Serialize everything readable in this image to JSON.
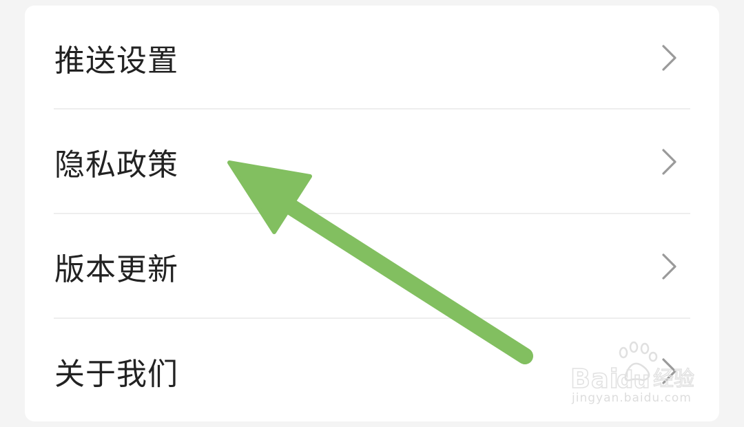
{
  "settings": {
    "items": [
      {
        "label": "推送设置",
        "icon": "chevron-right-icon"
      },
      {
        "label": "隐私政策",
        "icon": "chevron-right-icon"
      },
      {
        "label": "版本更新",
        "icon": "chevron-right-icon"
      },
      {
        "label": "关于我们",
        "icon": "chevron-right-icon"
      }
    ]
  },
  "annotation": {
    "arrow_color": "#82bf60",
    "arrow_target": "隐私政策"
  },
  "watermark": {
    "brand": "Baidu经验",
    "url": "jingyan.baidu.com"
  },
  "colors": {
    "background": "#f4f4f4",
    "card": "#ffffff",
    "text": "#222222",
    "chevron": "#9a9a9a",
    "divider": "#eeeeee"
  }
}
